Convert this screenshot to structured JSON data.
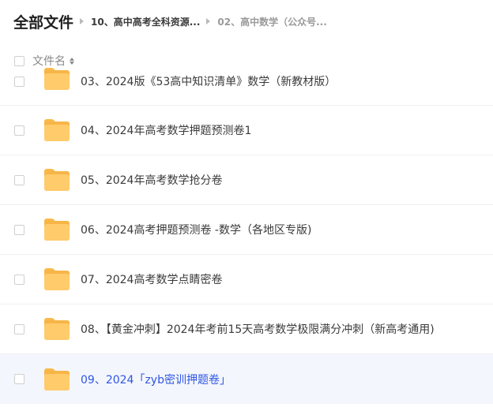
{
  "breadcrumb": {
    "root": "全部文件",
    "items": [
      "10、高中高考全科资源...",
      "02、高中数学（公众号..."
    ]
  },
  "list_header": {
    "name_label": "文件名"
  },
  "files": [
    {
      "name": "03、2024版《53高中知识清单》数学（新教材版）"
    },
    {
      "name": "04、2024年高考数学押题预测卷1"
    },
    {
      "name": "05、2024年高考数学抢分卷"
    },
    {
      "name": "06、2024高考押题预测卷 -数学（各地区专版)"
    },
    {
      "name": "07、2024高考数学点睛密卷"
    },
    {
      "name": "08、【黄金冲刺】2024年考前15天高考数学极限满分冲刺（新高考通用)"
    },
    {
      "name": "09、2024「zyb密训押题卷」"
    }
  ],
  "colors": {
    "folder": "#ffcb6b",
    "hover_bg": "#f4f6fd",
    "link": "#2e56e3"
  }
}
